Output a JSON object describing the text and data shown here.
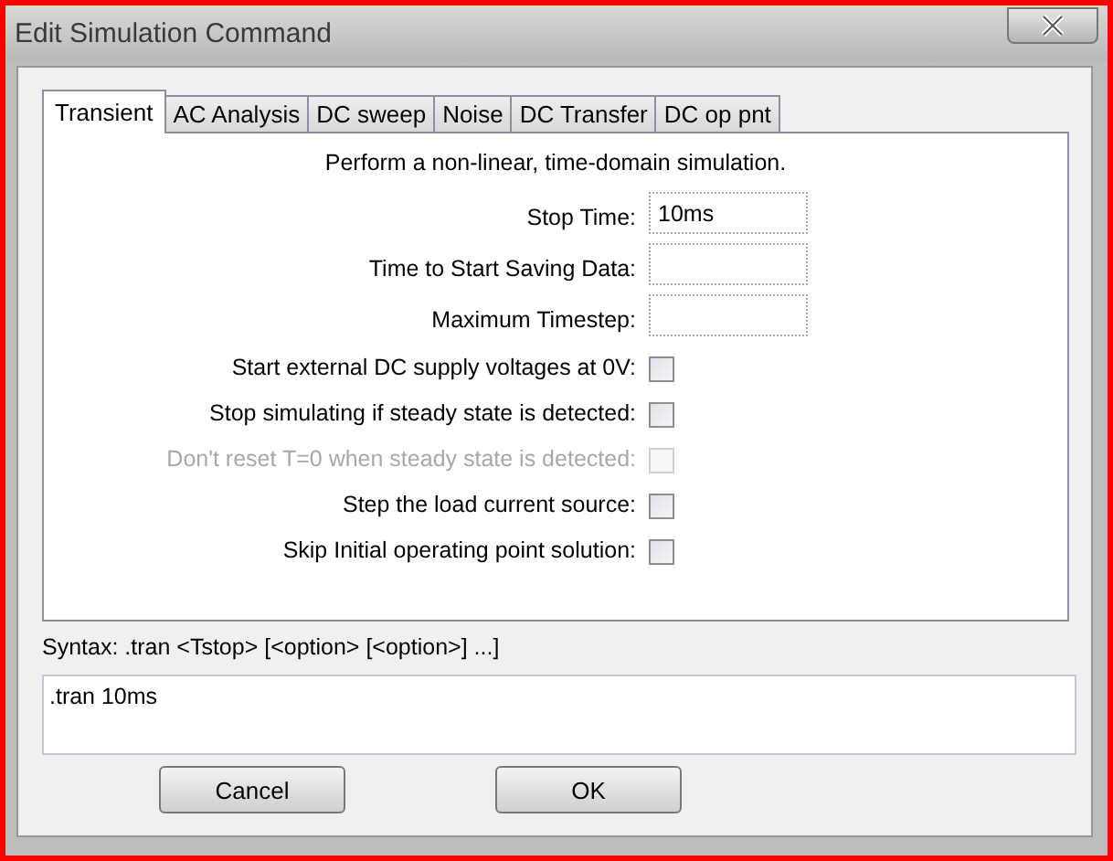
{
  "window": {
    "title": "Edit Simulation Command"
  },
  "tabs": [
    {
      "label": "Transient",
      "selected": true
    },
    {
      "label": "AC Analysis",
      "selected": false
    },
    {
      "label": "DC sweep",
      "selected": false
    },
    {
      "label": "Noise",
      "selected": false
    },
    {
      "label": "DC Transfer",
      "selected": false
    },
    {
      "label": "DC op pnt",
      "selected": false
    }
  ],
  "description": "Perform a non-linear, time-domain simulation.",
  "fields": [
    {
      "label": "Stop Time:",
      "value": "10ms"
    },
    {
      "label": "Time to Start Saving Data:"
    },
    {
      "label": "Maximum Timestep:"
    }
  ],
  "options": [
    {
      "label": "Start external DC supply voltages at 0V:",
      "checked": false,
      "disabled": false
    },
    {
      "label": "Stop simulating if steady state is detected:",
      "checked": false,
      "disabled": false
    },
    {
      "label": "Don't reset T=0 when steady state is detected:",
      "checked": false,
      "disabled": true
    },
    {
      "label": "Step the load current source:",
      "checked": false,
      "disabled": false
    },
    {
      "label": "Skip Initial operating point solution:",
      "checked": false,
      "disabled": false
    }
  ],
  "syntax": "Syntax:  .tran <Tstop> [<option> [<option>] ...]",
  "command": ".tran 10ms",
  "buttons": [
    "Cancel",
    "OK"
  ]
}
